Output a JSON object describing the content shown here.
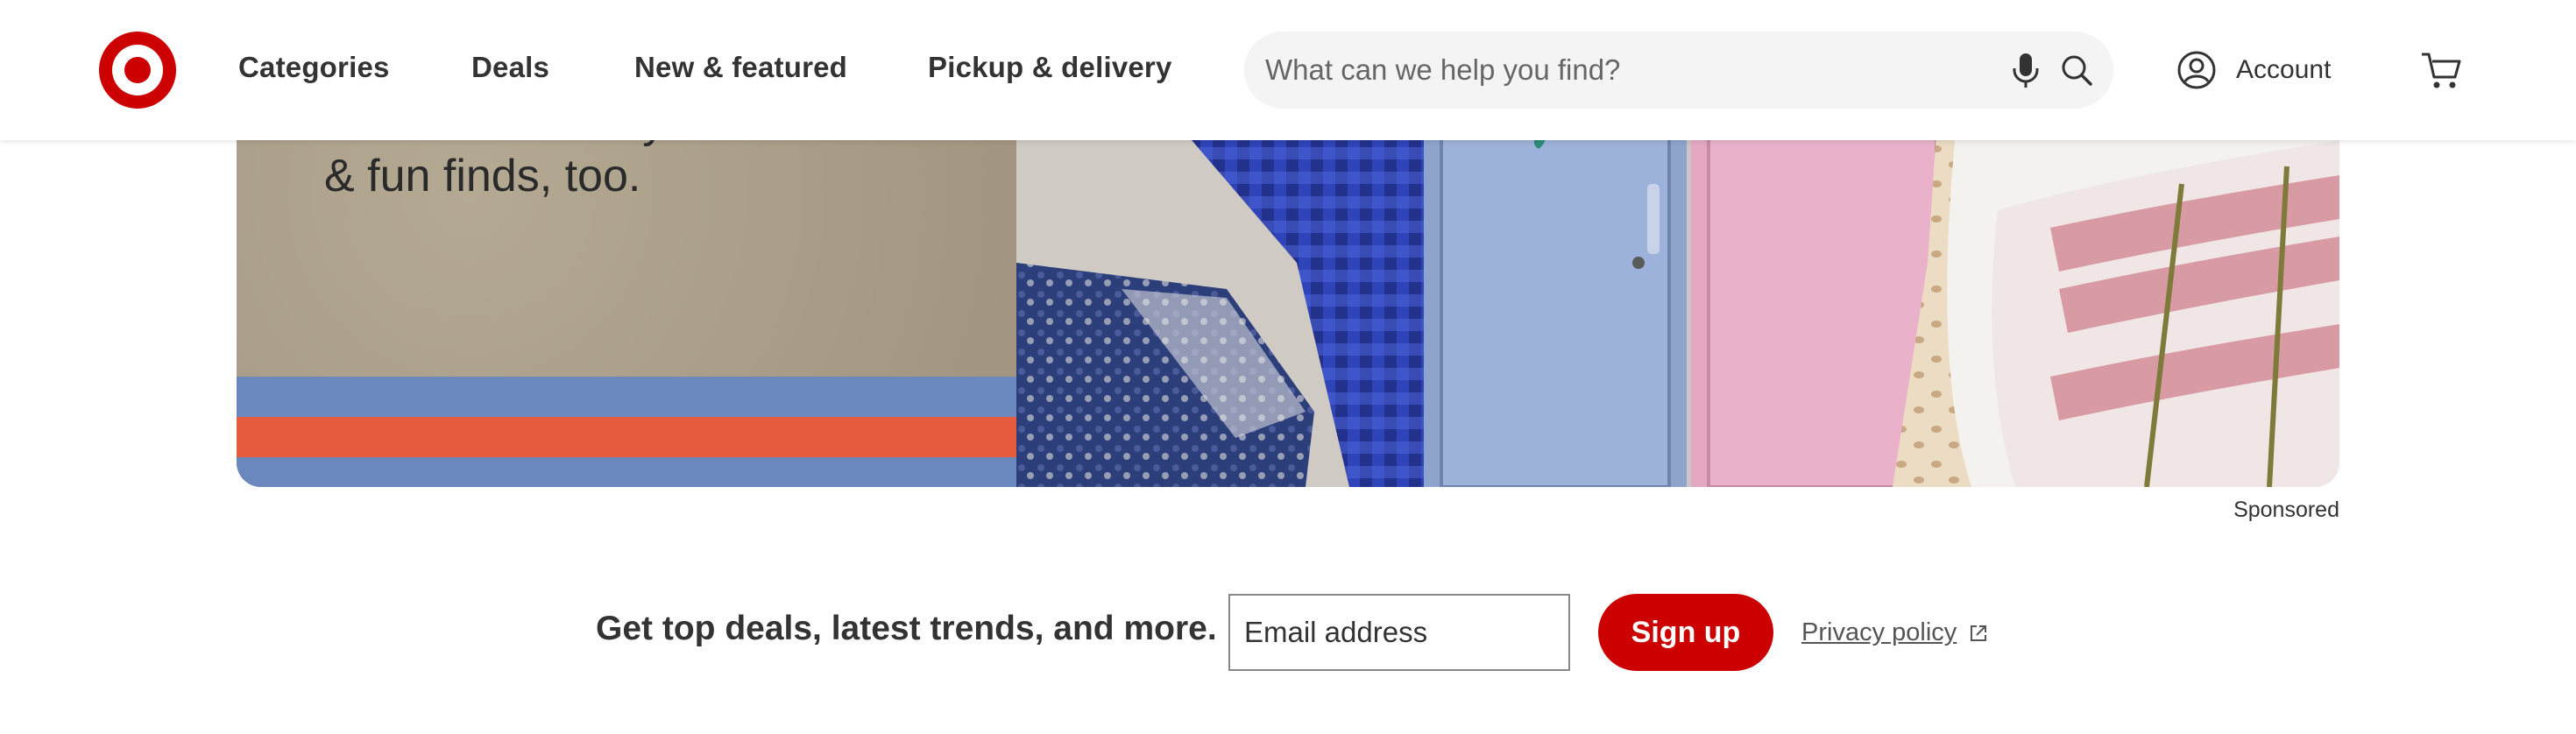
{
  "header": {
    "nav": [
      "Categories",
      "Deals",
      "New & featured",
      "Pickup & delivery"
    ],
    "search_placeholder": "What can we help you find?",
    "account_label": "Account"
  },
  "banner": {
    "headline_line1": "Get all the stuff you need",
    "headline_line2": "& fun finds, too.",
    "sponsored_label": "Sponsored"
  },
  "newsletter": {
    "text": "Get top deals, latest trends, and more.",
    "email_placeholder": "Email address",
    "signup_label": "Sign up",
    "privacy_label": "Privacy policy"
  },
  "icons": {
    "logo": "target-bullseye-icon",
    "mic": "microphone-icon",
    "search": "search-icon",
    "account": "account-icon",
    "cart": "cart-icon",
    "external": "external-link-icon"
  },
  "colors": {
    "brand_red": "#cc0000",
    "stripe_blue": "#6a88bd",
    "stripe_orange": "#e55c3e",
    "banner_tan": "#a89c86"
  }
}
